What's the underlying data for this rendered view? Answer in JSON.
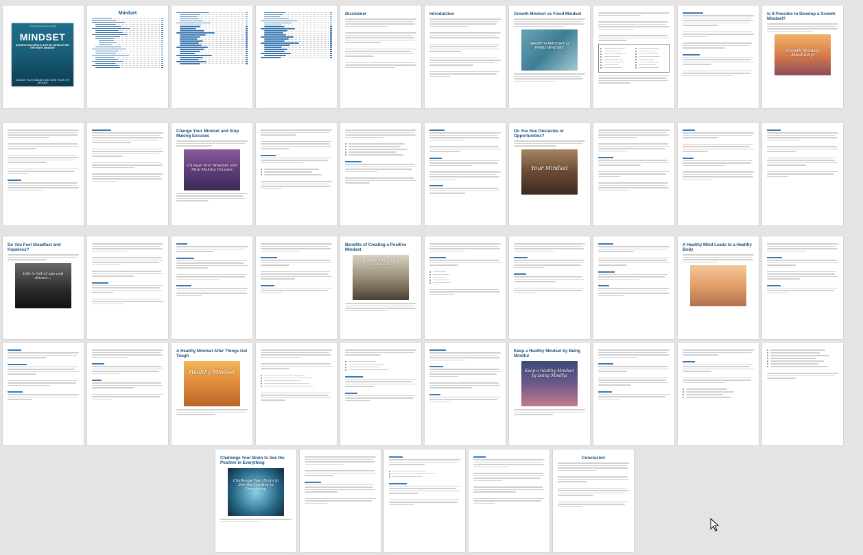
{
  "document": {
    "cover": {
      "header": "Personal Development Guide",
      "title": "MINDSET",
      "subtitle": "ACHIEVE SUCCESS IN LIFE BY DEVELOPING THE RIGHT MINDSET",
      "bottom": "CHANGE YOUR MINDSET AND TURN YOUR LIFE AROUND"
    },
    "toc_title": "Mindset",
    "headings": {
      "disclaimer": "Disclaimer",
      "introduction": "Introduction",
      "growth_vs_fixed": "Growth Mindset vs Fixed Mindset",
      "possible_growth": "Is It Possible to Develop a Growth Mindset?",
      "change_mindset": "Change Your Mindset and Stop Making Excuses",
      "obstacle": "Do You See Obstacles or Opportunities?",
      "steadfast": "Do You Feel Steadfast and Hopeless?",
      "benefits_positive": "Benefits of Creating a Positive Mindset",
      "healthy_mind": "A Healthy Mind Leads to a Healthy Body",
      "healthy_after": "A Healthy Mindset After Things Get Tough",
      "mindful": "Keep a Healthy Mindset by Being Mindful",
      "challenge": "Challenge Your Brain to See the Positive in Everything",
      "conclusion": "Conclusion"
    },
    "image_captions": {
      "growth": "GROWTH MINDSET vs FIXED MINDSET",
      "absolutely": "Growth Mindset Absolutely!",
      "change": "Change Your Mindset and Stop Making Excuses",
      "your_mindset": "Your Mindset",
      "life_ups": "Life is full of ups and downs...",
      "healthy_positive": "HEALTHY, POSITIVE MINDSET",
      "healthy_mindset": "Healthy Mindset",
      "mindful": "Keep a healthy Mindset by being Mindful",
      "challenge": "Challenge Your Brain to See the Positive in Everything"
    }
  }
}
